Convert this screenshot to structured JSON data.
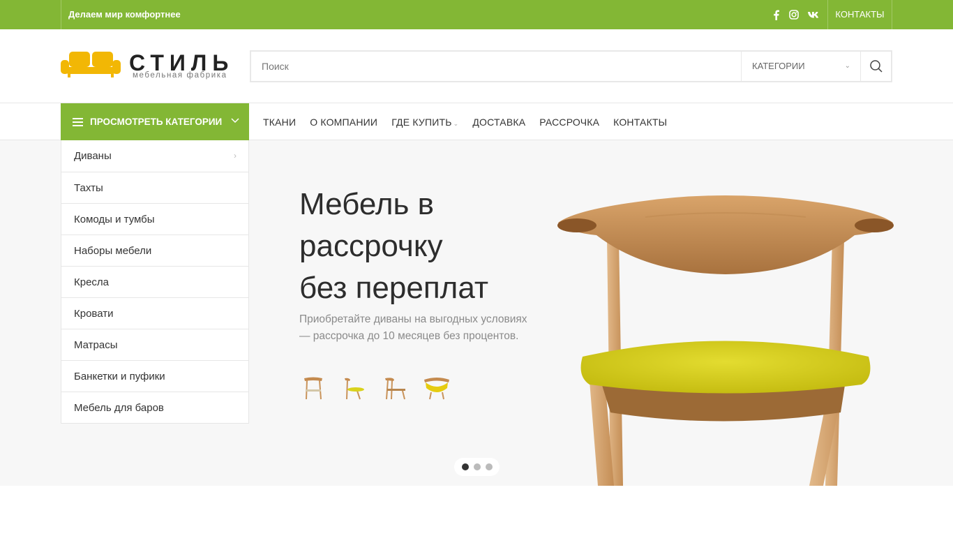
{
  "topbar": {
    "tagline": "Делаем мир комфортнее",
    "social": [
      "facebook-icon",
      "instagram-icon",
      "vk-icon"
    ],
    "contacts": "КОНТАКТЫ"
  },
  "logo": {
    "name": "СТИЛЬ",
    "subtitle": "мебельная фабрика"
  },
  "search": {
    "placeholder": "Поиск",
    "categories_label": "КАТЕГОРИИ"
  },
  "nav": {
    "browse_categories": "ПРОСМОТРЕТЬ КАТЕГОРИИ",
    "items": [
      "ТКАНИ",
      "О КОМПАНИИ",
      "ГДЕ КУПИТЬ",
      "ДОСТАВКА",
      "РАССРОЧКА",
      "КОНТАКТЫ"
    ]
  },
  "sidebar": {
    "items": [
      "Диваны",
      "Тахты",
      "Комоды и тумбы",
      "Наборы мебели",
      "Кресла",
      "Кровати",
      "Матрасы",
      "Банкетки и пуфики",
      "Мебель для баров"
    ]
  },
  "hero": {
    "title_line1": "Мебель в",
    "title_line2": "рассрочку",
    "title_line3": "без переплат",
    "text": "Приобретайте диваны на выгодных условиях — рассрочка до 10 месяцев без процентов.",
    "slide_count": 3,
    "active_slide": 1
  },
  "colors": {
    "accent": "#83b735",
    "logo_yellow": "#f2b705",
    "seat_yellow": "#d9d21c"
  }
}
